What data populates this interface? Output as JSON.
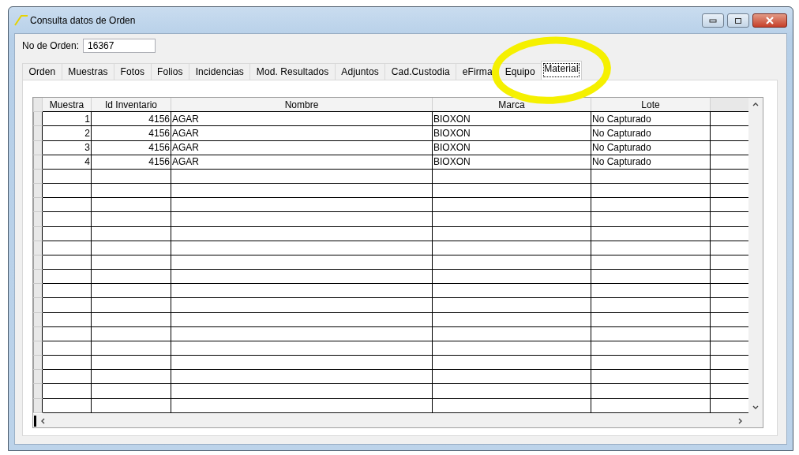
{
  "window": {
    "title": "Consulta datos de Orden"
  },
  "order_field": {
    "label": "No de Orden:",
    "value": "16367"
  },
  "tabs": [
    {
      "label": "Orden",
      "selected": false
    },
    {
      "label": "Muestras",
      "selected": false
    },
    {
      "label": "Fotos",
      "selected": false
    },
    {
      "label": "Folios",
      "selected": false
    },
    {
      "label": "Incidencias",
      "selected": false
    },
    {
      "label": "Mod. Resultados",
      "selected": false
    },
    {
      "label": "Adjuntos",
      "selected": false
    },
    {
      "label": "Cad.Custodia",
      "selected": false
    },
    {
      "label": "eFirma",
      "selected": false
    },
    {
      "label": "Equipo",
      "selected": false
    },
    {
      "label": "Material",
      "selected": true
    }
  ],
  "table": {
    "columns": [
      "Muestra",
      "Id Inventario",
      "Nombre",
      "Marca",
      "Lote"
    ],
    "rows": [
      [
        "1",
        "4156",
        "AGAR",
        "BIOXON",
        "No Capturado"
      ],
      [
        "2",
        "4156",
        "AGAR",
        "BIOXON",
        "No Capturado"
      ],
      [
        "3",
        "4156",
        "AGAR",
        "BIOXON",
        "No Capturado"
      ],
      [
        "4",
        "4156",
        "AGAR",
        "BIOXON",
        "No Capturado"
      ]
    ]
  }
}
